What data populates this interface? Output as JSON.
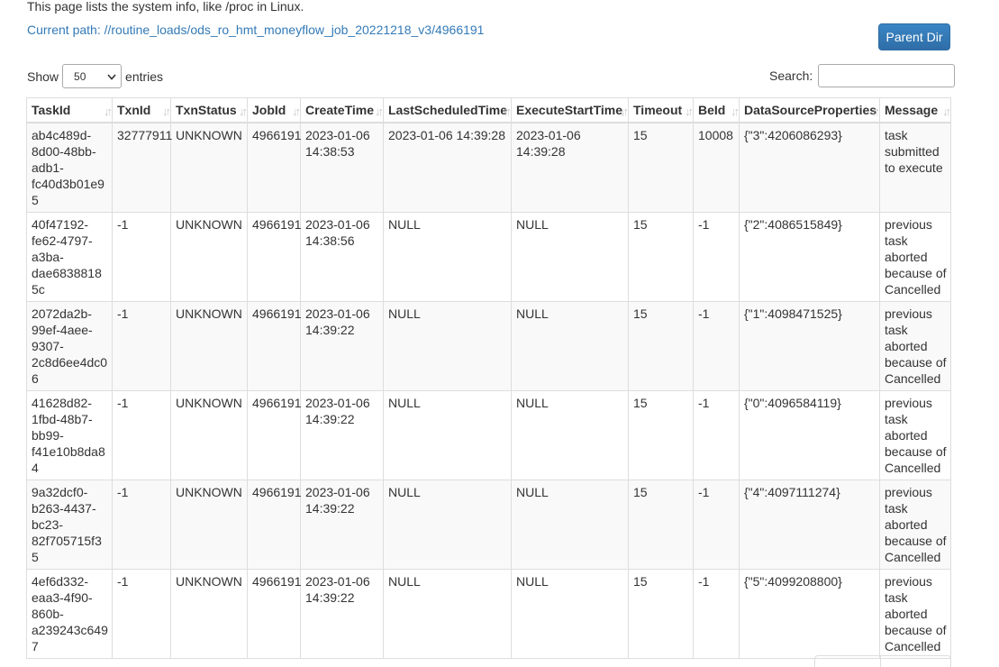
{
  "intro_text": "This page lists the system info, like /proc in Linux.",
  "current_path": "Current path: //routine_loads/ods_ro_hmt_moneyflow_job_20221218_v3/4966191",
  "parent_dir_label": "Parent Dir",
  "length_control": {
    "show_label": "Show",
    "selected": "50",
    "entries_label": "entries"
  },
  "search": {
    "label": "Search:",
    "value": ""
  },
  "columns": [
    "TaskId",
    "TxnId",
    "TxnStatus",
    "JobId",
    "CreateTime",
    "LastScheduledTime",
    "ExecuteStartTime",
    "Timeout",
    "BeId",
    "DataSourceProperties",
    "Message"
  ],
  "rows": [
    {
      "task_id": "ab4c489d-8d00-48bb-adb1-fc40d3b01e95",
      "txn_id": "32777911",
      "txn_status": "UNKNOWN",
      "job_id": "4966191",
      "create_time": "2023-01-06 14:38:53",
      "last_scheduled_time": "2023-01-06 14:39:28",
      "execute_start_time": "2023-01-06 14:39:28",
      "timeout": "15",
      "be_id": "10008",
      "data_source_properties": "{\"3\":4206086293}",
      "message": "task submitted to execute"
    },
    {
      "task_id": "40f47192-fe62-4797-a3ba-dae68388185c",
      "txn_id": "-1",
      "txn_status": "UNKNOWN",
      "job_id": "4966191",
      "create_time": "2023-01-06 14:38:56",
      "last_scheduled_time": "NULL",
      "execute_start_time": "NULL",
      "timeout": "15",
      "be_id": "-1",
      "data_source_properties": "{\"2\":4086515849}",
      "message": "previous task aborted because of Cancelled"
    },
    {
      "task_id": "2072da2b-99ef-4aee-9307-2c8d6ee4dc06",
      "txn_id": "-1",
      "txn_status": "UNKNOWN",
      "job_id": "4966191",
      "create_time": "2023-01-06 14:39:22",
      "last_scheduled_time": "NULL",
      "execute_start_time": "NULL",
      "timeout": "15",
      "be_id": "-1",
      "data_source_properties": "{\"1\":4098471525}",
      "message": "previous task aborted because of Cancelled"
    },
    {
      "task_id": "41628d82-1fbd-48b7-bb99-f41e10b8da84",
      "txn_id": "-1",
      "txn_status": "UNKNOWN",
      "job_id": "4966191",
      "create_time": "2023-01-06 14:39:22",
      "last_scheduled_time": "NULL",
      "execute_start_time": "NULL",
      "timeout": "15",
      "be_id": "-1",
      "data_source_properties": "{\"0\":4096584119}",
      "message": "previous task aborted because of Cancelled"
    },
    {
      "task_id": "9a32dcf0-b263-4437-bc23-82f705715f35",
      "txn_id": "-1",
      "txn_status": "UNKNOWN",
      "job_id": "4966191",
      "create_time": "2023-01-06 14:39:22",
      "last_scheduled_time": "NULL",
      "execute_start_time": "NULL",
      "timeout": "15",
      "be_id": "-1",
      "data_source_properties": "{\"4\":4097111274}",
      "message": "previous task aborted because of Cancelled"
    },
    {
      "task_id": "4ef6d332-eaa3-4f90-860b-a239243c6497",
      "txn_id": "-1",
      "txn_status": "UNKNOWN",
      "job_id": "4966191",
      "create_time": "2023-01-06 14:39:22",
      "last_scheduled_time": "NULL",
      "execute_start_time": "NULL",
      "timeout": "15",
      "be_id": "-1",
      "data_source_properties": "{\"5\":4099208800}",
      "message": "previous task aborted because of Cancelled"
    }
  ],
  "icons": {
    "sort": "sort-both-icon",
    "select": "chevron-down-icon"
  }
}
